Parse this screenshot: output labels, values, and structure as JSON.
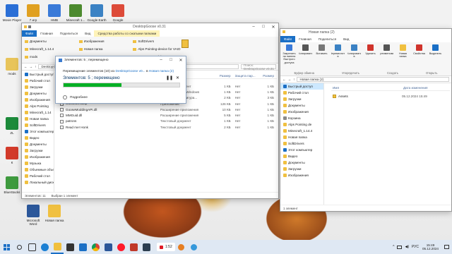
{
  "desktop": {
    "icons": [
      {
        "label": "Movie Player",
        "color": "#2b6fd6"
      },
      {
        "label": "7 игр",
        "color": "#e0a020"
      },
      {
        "label": "HMB",
        "color": "#3a7ad8"
      },
      {
        "label": "Minecraft 1...",
        "color": "#4c8a2e"
      },
      {
        "label": "Google Earth Pro",
        "color": "#3b82c4"
      },
      {
        "label": "Google Chrome",
        "color": "#dd4b39"
      },
      {
        "label": "mods",
        "color": "#e8c45a"
      },
      {
        "label": "ZL",
        "color": "#1c8a3a"
      },
      {
        "label": "К",
        "color": "#d23a2a"
      },
      {
        "label": "BlueStacks",
        "color": "#3e9a3e"
      },
      {
        "label": "Microsoft Word",
        "color": "#2b579a"
      },
      {
        "label": "Новая папка",
        "color": "#f0c040"
      }
    ]
  },
  "win1": {
    "title": "DesktopGoose v0.31",
    "tabs": [
      "Файл",
      "Главная",
      "Поделиться",
      "Вид",
      "Средства работы со сжатыми папками"
    ],
    "ribbon_items": [
      "Документы",
      "Изображения",
      "SoftDrivers",
      "Minecraft_1.14.4",
      "Новая папка",
      "Alps Pointing-device for VAIO",
      "mods",
      "Музыка",
      "Новая папка (2)"
    ],
    "address": "DesktopGoose v0.31",
    "search": "Поиск: DesktopGoose v0.31",
    "nav": [
      "Быстрый доступ",
      "Рабочий стол",
      "Загрузки",
      "Документы",
      "Изображения",
      "Alps Pointing",
      "Minecraft_1.14",
      "Новая папка",
      "SoftDrivers",
      "Этот компьютер",
      "Видео",
      "Документы",
      "Загрузки",
      "Изображения",
      "Музыка",
      "Объемные объекты",
      "Рабочий стол",
      "Локальный диск"
    ],
    "columns": [
      "Имя",
      "Дата изменения",
      "Тип",
      "Размер",
      "Защита пар...",
      "Размер"
    ],
    "files": [
      {
        "name": "changelog",
        "type": "Текстовый документ",
        "size": "1 КБ",
        "prot": "Нет",
        "size2": "1 КБ"
      },
      {
        "name": "Close Goose",
        "type": "Текстовый файл Windows",
        "size": "1 КБ",
        "prot": "Нет",
        "size2": "1 КБ"
      },
      {
        "name": "config",
        "type": "Параметры конфигура...",
        "size": "2 КБ",
        "prot": "Нет",
        "size2": "3 КБ"
      },
      {
        "name": "GooseDesktop",
        "type": "Приложение",
        "size": "126 КБ",
        "prot": "Нет",
        "size2": "1 КБ"
      },
      {
        "name": "GooseModdingAPI.dll",
        "type": "Расширение приложения",
        "size": "10 КБ",
        "prot": "Нет",
        "size2": "1 КБ"
      },
      {
        "name": "MMGuid.dll",
        "type": "Расширение приложения",
        "size": "5 КБ",
        "prot": "Нет",
        "size2": "1 КБ"
      },
      {
        "name": "patrons",
        "type": "Текстовый документ",
        "size": "1 КБ",
        "prot": "Нет",
        "size2": "1 КБ"
      },
      {
        "name": "Read me! Honk",
        "type": "Текстовый документ",
        "size": "2 КБ",
        "prot": "Нет",
        "size2": "1 КБ"
      }
    ],
    "status_count": "Элементов: 11",
    "status_sel": "Выбран 1 элемент"
  },
  "dialog": {
    "title": "Элементов: 5 ; перемещено",
    "line_prefix": "Перемещение элементов (10) из",
    "line_from": "DesktopGoose v0...",
    "line_mid": "в",
    "line_to": "Новая папка (2)",
    "status": "Элементов: 5 ; перемещено",
    "progress_fraction": 0.5,
    "details": "Подробнее"
  },
  "win2": {
    "title": "Новая папка (2)",
    "tabs": [
      "Файл",
      "Главная",
      "Поделиться",
      "Вид"
    ],
    "ribbon_buttons": [
      "Закрепить на панели быстрого доступа",
      "Копировать",
      "Вставить",
      "Переместить в",
      "Копировать в",
      "Удалить",
      "Переименовать",
      "Новая папка",
      "Свойства",
      "Выделить"
    ],
    "ribbon_groups": [
      "Буфер обмена",
      "Упорядочить",
      "Создать",
      "Открыть"
    ],
    "address": "Новая папка (2)",
    "nav": [
      "Быстрый доступ",
      "Рабочий стол",
      "Загрузки",
      "Документы",
      "Изображения",
      "Корзина",
      "Alps Pointing de",
      "Minecraft_1.14.4",
      "Новая папка",
      "SoftDrivers",
      "Этот компьютер",
      "Видео",
      "Документы",
      "Загрузки",
      "Изображения"
    ],
    "columns": [
      "Имя",
      "Дата изменения"
    ],
    "files": [
      {
        "name": "Assets",
        "date": "05.12.2024 15:49"
      }
    ],
    "status_count": "1 элемент"
  },
  "taskbar": {
    "recording": "1:52",
    "lang": "РУС",
    "time": "15:49",
    "date": "05.12.2024"
  }
}
